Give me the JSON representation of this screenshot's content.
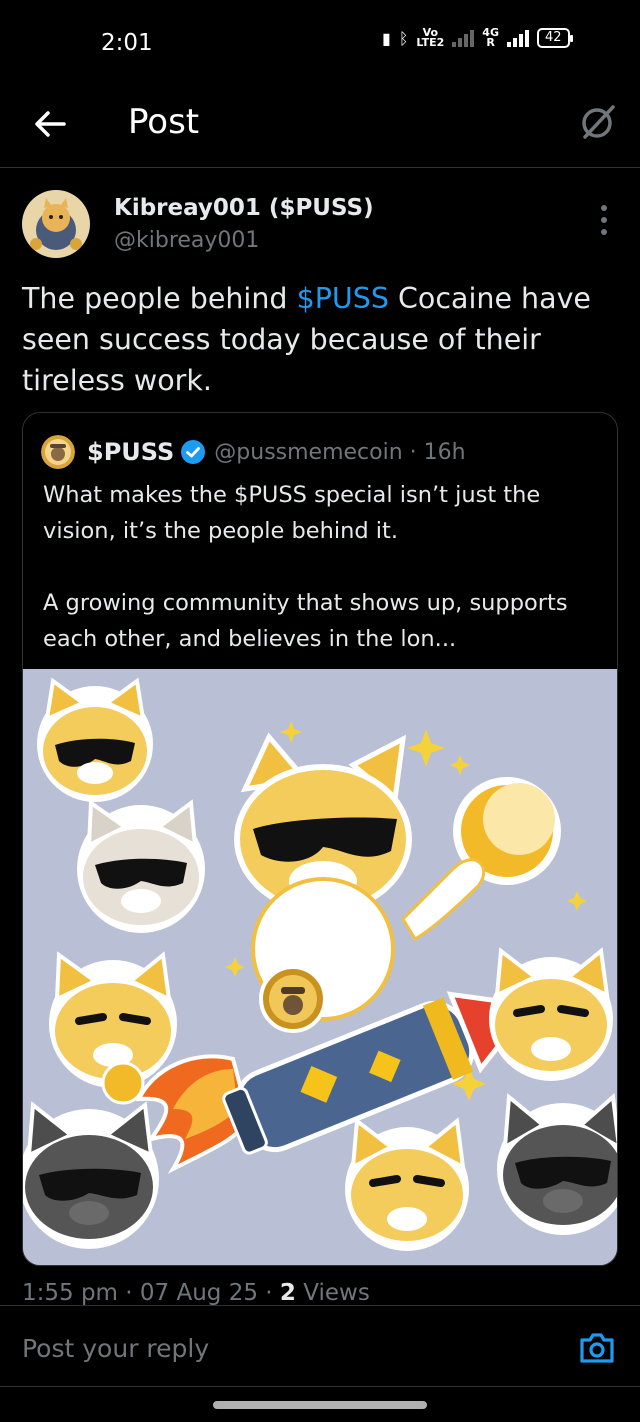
{
  "status_bar": {
    "time": "2:01",
    "volte": "Vo",
    "lte": "LTE2",
    "network": "4G",
    "roaming": "R",
    "battery": "42"
  },
  "header": {
    "title": "Post",
    "back_icon": "back-arrow-icon",
    "grok_icon": "grok-icon"
  },
  "post": {
    "author_name": "Kibreay001 ($PUSS)",
    "author_handle": "@kibreay001",
    "text_before": "The people behind ",
    "cashtag": "$PUSS",
    "text_after": " Cocaine have seen success today because of their tireless work.",
    "timestamp": "1:55 pm · 07 Aug 25 · ",
    "views_count": "2",
    "views_label": " Views"
  },
  "quote": {
    "name": "$PUSS",
    "handle_time": "@pussmemecoin · 16h",
    "paragraph1": "What makes the $PUSS special isn’t just the vision, it’s the people behind it.",
    "paragraph2": "A growing community that shows up, supports each other, and believes in the lon..."
  },
  "reply": {
    "placeholder": "Post your reply"
  },
  "colors": {
    "accent": "#1d9bf0",
    "background": "#000000",
    "muted": "#71767b",
    "border": "#2f3336"
  }
}
